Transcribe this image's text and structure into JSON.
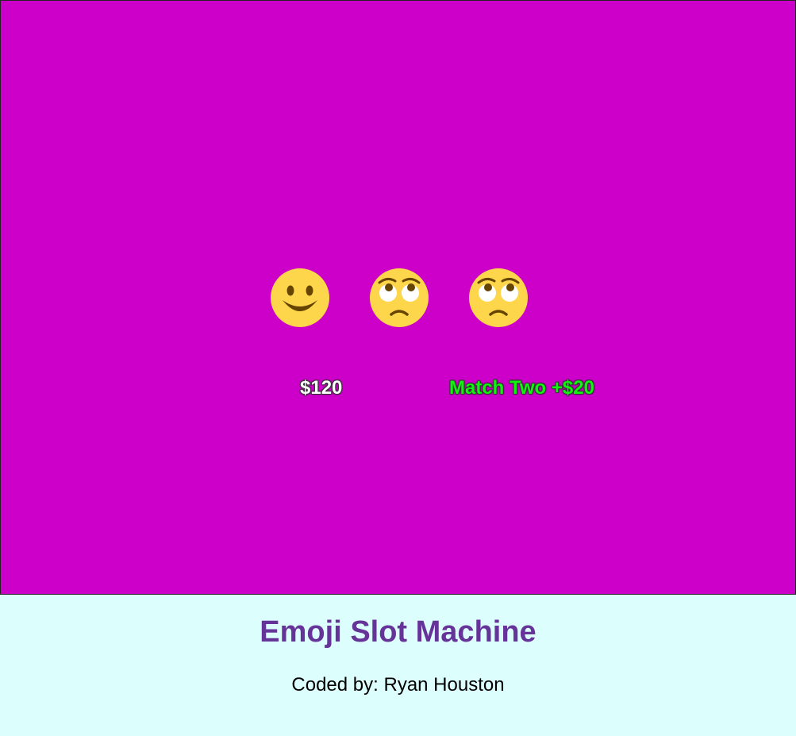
{
  "game": {
    "background_color": "#cc00c8",
    "reels": [
      {
        "emoji": "🙂",
        "icon": "slightly-smiling-face-icon"
      },
      {
        "emoji": "🙄",
        "icon": "face-with-rolling-eyes-icon"
      },
      {
        "emoji": "🙄",
        "icon": "face-with-rolling-eyes-icon"
      }
    ],
    "money": "$120",
    "result": "Match Two +$20",
    "result_color": "#12f312"
  },
  "footer": {
    "title": "Emoji Slot Machine",
    "credit": "Coded by: Ryan Houston"
  }
}
